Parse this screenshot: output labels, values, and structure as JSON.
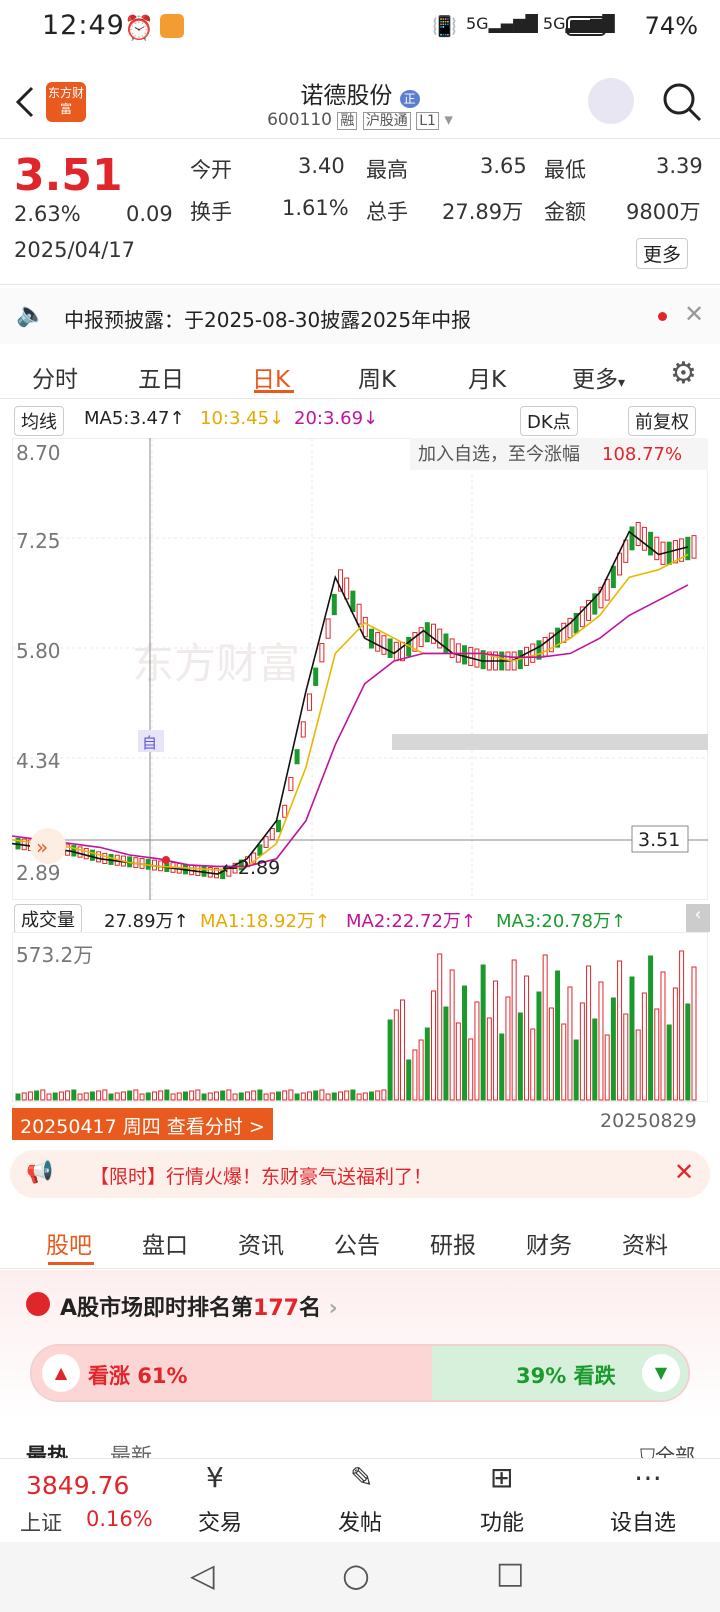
{
  "status": {
    "time": "12:49",
    "signal": "5G 5G",
    "battery": "74%"
  },
  "header": {
    "title": "诺德股份",
    "code": "600110",
    "badges": [
      "融",
      "沪股通",
      "L1"
    ],
    "logo_text": "东方财富",
    "title_badge": "正"
  },
  "quote": {
    "price": "3.51",
    "pct": "2.63%",
    "chg": "0.09",
    "date": "2025/04/17",
    "open_label": "今开",
    "open": "3.40",
    "high_label": "最高",
    "high": "3.65",
    "low_label": "最低",
    "low": "3.39",
    "turn_label": "换手",
    "turn": "1.61%",
    "vol_label": "总手",
    "vol": "27.89万",
    "amt_label": "金额",
    "amt": "9800万",
    "more": "更多"
  },
  "notice": {
    "text": "中报预披露：于2025-08-30披露2025年中报"
  },
  "tabs": [
    "分时",
    "五日",
    "日K",
    "周K",
    "月K",
    "更多"
  ],
  "chart_bar": {
    "ma_label": "均线",
    "ma5": "MA5:3.47↑",
    "ma10": "10:3.45↓",
    "ma20": "20:3.69↓",
    "dk": "DK点",
    "fq": "前复权"
  },
  "kline": {
    "y_labels": [
      "8.70",
      "7.25",
      "5.80",
      "4.34",
      "2.89"
    ],
    "gain_label": "加入自选，至今涨幅",
    "gain": "108.77%",
    "price_tag": "3.51",
    "low_tag": "2.89",
    "self_mark": "自",
    "watermark": "东方财富"
  },
  "volume": {
    "label": "成交量",
    "val": "27.89万↑",
    "ma1": "MA1:18.92万↑",
    "ma2": "MA2:22.72万↑",
    "ma3": "MA3:20.78万↑",
    "max": "573.2万",
    "date_left": "20250417 周四 查看分时 >",
    "date_right": "20250829"
  },
  "promo": {
    "text": "【限时】行情火爆！东财豪气送福利了！"
  },
  "subtabs": [
    "股吧",
    "盘口",
    "资讯",
    "公告",
    "研报",
    "财务",
    "资料"
  ],
  "rank": {
    "prefix": "A股市场即时排名第",
    "num": "177",
    "suffix": "名",
    "up": "看涨 61%",
    "down": "39% 看跌"
  },
  "partial": {
    "hot": "最热",
    "new": "最新",
    "all": "全部"
  },
  "footer": {
    "index": "3849.76",
    "index_name": "上证",
    "index_pct": "0.16%",
    "items": [
      "交易",
      "发帖",
      "功能",
      "设自选"
    ]
  },
  "colors": {
    "red": "#e0262b",
    "green": "#1a9a2c",
    "accent": "#e85a1e"
  },
  "chart_data": {
    "type": "candlestick",
    "note": "daily K-line",
    "series": [
      {
        "name": "MA5",
        "values": [
          3.5,
          3.45,
          3.4,
          3.3,
          3.25,
          3.2,
          3.15,
          3.1,
          3.3,
          3.8,
          5.5,
          7.0,
          6.2,
          6.0,
          6.3,
          6.0,
          5.9,
          5.9,
          6.1,
          6.4,
          6.8,
          7.6,
          7.3,
          7.4
        ]
      },
      {
        "name": "MA10",
        "values": [
          3.55,
          3.5,
          3.45,
          3.35,
          3.25,
          3.2,
          3.18,
          3.15,
          3.2,
          3.5,
          4.5,
          6.0,
          6.4,
          6.2,
          6.0,
          6.0,
          6.0,
          5.9,
          6.0,
          6.2,
          6.5,
          7.0,
          7.1,
          7.3
        ]
      },
      {
        "name": "MA20",
        "values": [
          3.6,
          3.55,
          3.5,
          3.45,
          3.35,
          3.3,
          3.22,
          3.2,
          3.2,
          3.3,
          3.8,
          4.8,
          5.6,
          5.9,
          6.0,
          6.0,
          6.0,
          5.95,
          5.95,
          6.0,
          6.2,
          6.5,
          6.7,
          6.9
        ]
      }
    ]
  }
}
